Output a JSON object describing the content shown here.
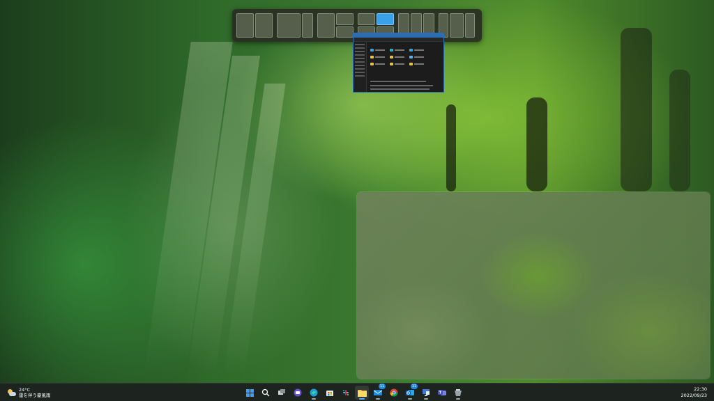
{
  "desktop": {
    "wallpaper": "green-forest",
    "accent": "#3aa0e8"
  },
  "snap_flyout": {
    "layouts": [
      "two-columns",
      "wide-left",
      "main-plus-stack",
      "quad",
      "three-columns",
      "two-equal-grid"
    ],
    "active_zone": "quad-top-right"
  },
  "explorer": {
    "state": "dragging"
  },
  "taskbar": {
    "weather": {
      "temperature": "24°C",
      "condition": "雷を伴う豪風雨"
    },
    "apps": [
      {
        "name": "start-button",
        "icon": "windows-logo-icon"
      },
      {
        "name": "search-button",
        "icon": "search-icon"
      },
      {
        "name": "task-view-button",
        "icon": "task-view-icon"
      },
      {
        "name": "chat-button",
        "icon": "chat-icon"
      },
      {
        "name": "edge-button",
        "icon": "edge-icon"
      },
      {
        "name": "store-button",
        "icon": "store-icon"
      },
      {
        "name": "slack-button",
        "icon": "slack-icon"
      },
      {
        "name": "file-explorer-button",
        "icon": "folder-icon"
      },
      {
        "name": "mail-button",
        "icon": "mail-icon",
        "badge": "11"
      },
      {
        "name": "chrome-button",
        "icon": "chrome-icon"
      },
      {
        "name": "outlook-button",
        "icon": "outlook-icon",
        "badge": "11"
      },
      {
        "name": "remote-desktop-button",
        "icon": "remote-desktop-icon"
      },
      {
        "name": "teams-button",
        "icon": "teams-icon"
      },
      {
        "name": "app-button",
        "icon": "app-icon"
      }
    ],
    "clock": {
      "time": "22:30",
      "date": "2022/09/23"
    }
  }
}
